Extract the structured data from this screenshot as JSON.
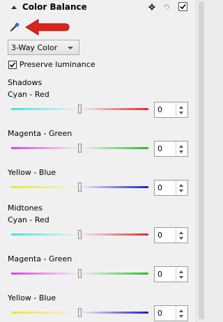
{
  "panel": {
    "title": "Color Balance",
    "icons": {
      "collapse": "collapse-triangle-icon",
      "settings": "gear-icon",
      "reset": "reset-icon",
      "enable": "checkbox-icon",
      "picker": "eyedropper-icon"
    },
    "enabled": true
  },
  "annotation_arrow_color": "#d9261c",
  "mode": {
    "selected": "3-Way Color"
  },
  "preserve_luminance": {
    "label": "Preserve luminance",
    "checked": true
  },
  "sections": [
    {
      "title": "Shadows",
      "sliders": [
        {
          "label": "Cyan - Red",
          "value": "0",
          "level": 0.5
        },
        {
          "label": "Magenta - Green",
          "value": "0",
          "level": 0.5
        },
        {
          "label": "Yellow - Blue",
          "value": "0",
          "level": 0.5
        }
      ]
    },
    {
      "title": "Midtones",
      "sliders": [
        {
          "label": "Cyan - Red",
          "value": "0",
          "level": 0.5
        },
        {
          "label": "Magenta - Green",
          "value": "0",
          "level": 0.5
        },
        {
          "label": "Yellow - Blue",
          "value": "0",
          "level": 0.5
        }
      ]
    }
  ],
  "gradients": {
    "cyan_red": [
      "#45e0e6",
      "#f1f1f1",
      "#e02a2a"
    ],
    "magenta_green": [
      "#e040e0",
      "#f1f1f1",
      "#2ac02a"
    ],
    "yellow_blue": [
      "#e8e830",
      "#f1f1f1",
      "#2020d0"
    ]
  }
}
